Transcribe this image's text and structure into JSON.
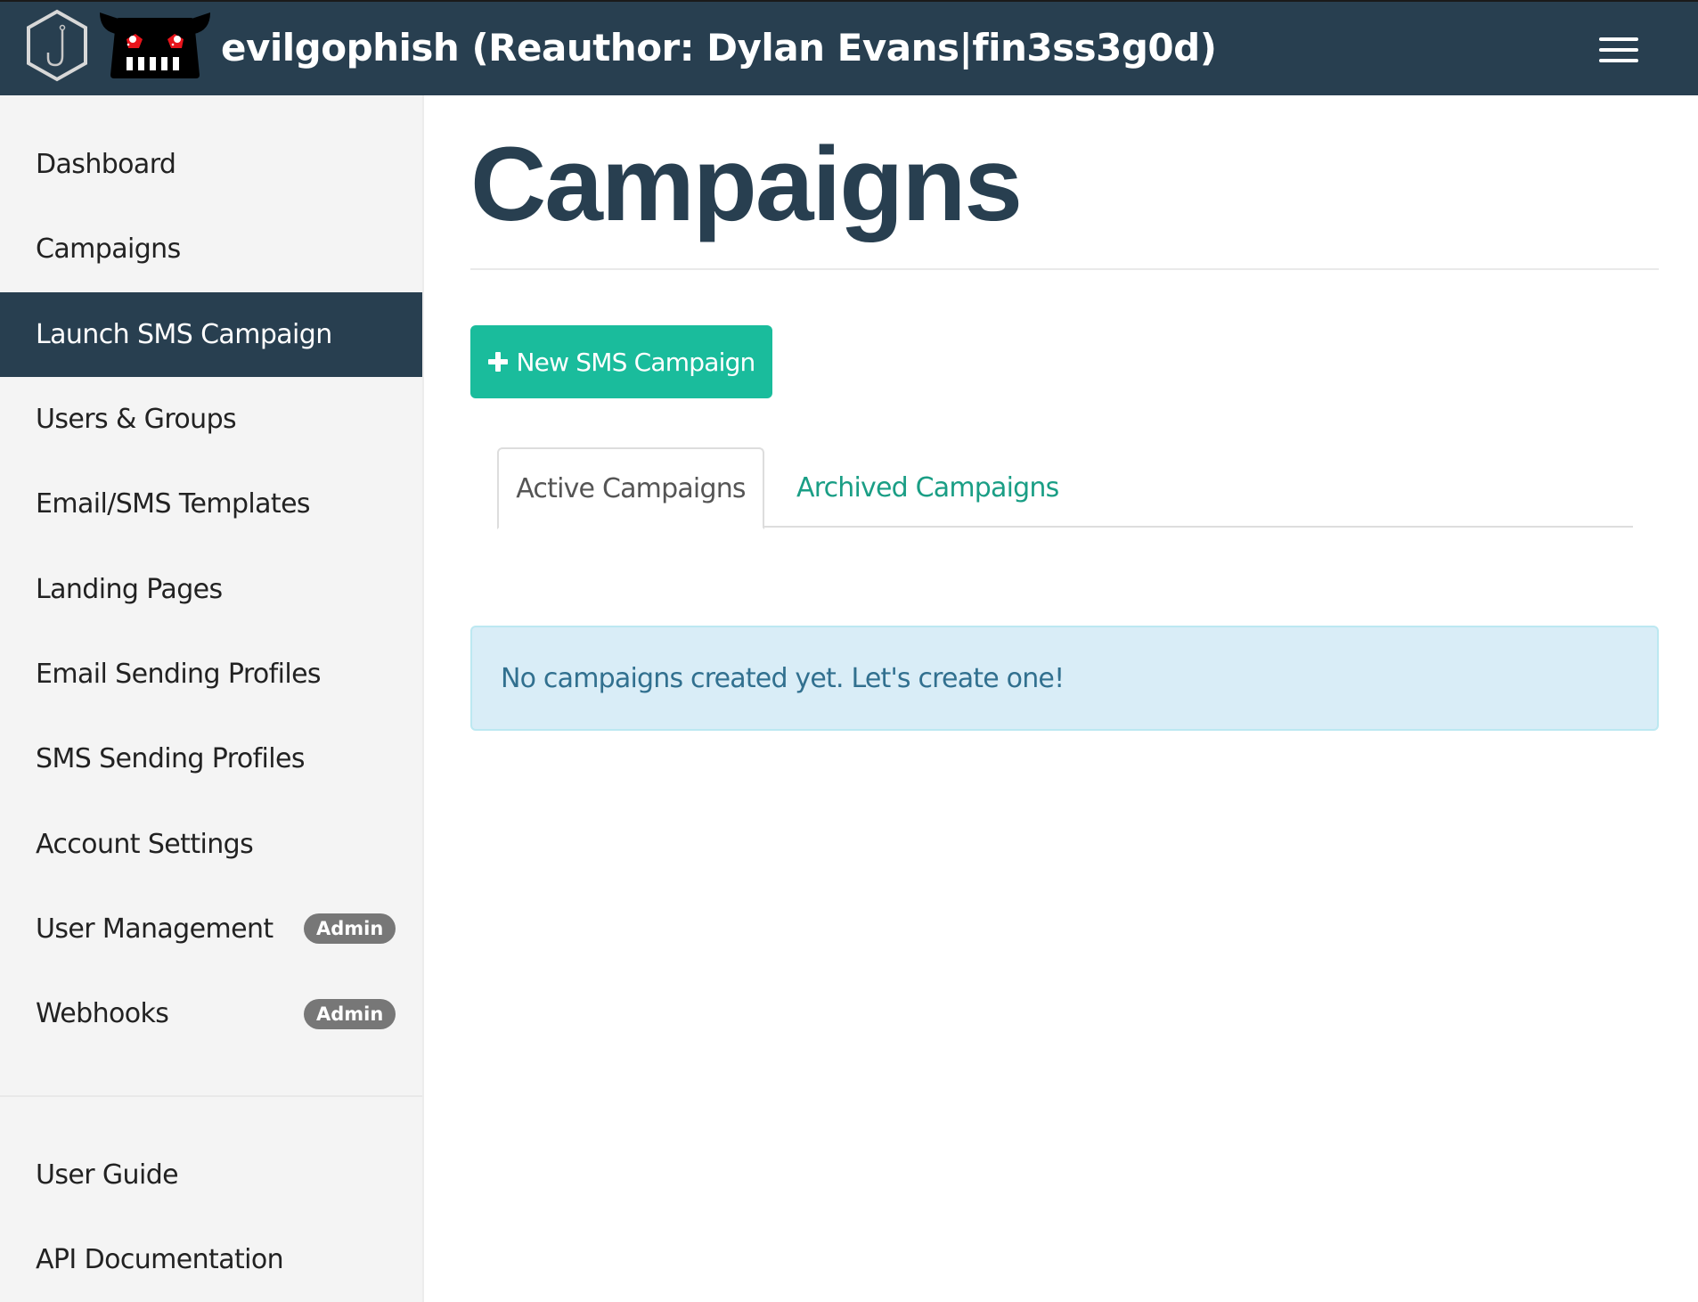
{
  "header": {
    "brand": "evilgophish (Reauthor: Dylan Evans|fin3ss3g0d)",
    "logo_icon": "hook-hexagon-icon",
    "mascot_icon": "evil-gopher-icon",
    "menu_icon": "hamburger-menu-icon"
  },
  "sidebar": {
    "items": [
      {
        "label": "Dashboard"
      },
      {
        "label": "Campaigns"
      },
      {
        "label": "Launch SMS Campaign",
        "active": true
      },
      {
        "label": "Users & Groups"
      },
      {
        "label": "Email/SMS Templates"
      },
      {
        "label": "Landing Pages"
      },
      {
        "label": "Email Sending Profiles"
      },
      {
        "label": "SMS Sending Profiles"
      },
      {
        "label": "Account Settings"
      },
      {
        "label": "User Management",
        "badge": "Admin"
      },
      {
        "label": "Webhooks",
        "badge": "Admin"
      }
    ],
    "secondary_items": [
      {
        "label": "User Guide"
      },
      {
        "label": "API Documentation"
      }
    ]
  },
  "main": {
    "title": "Campaigns",
    "new_button_label": "New SMS Campaign",
    "tabs": [
      {
        "label": "Active Campaigns",
        "active": true
      },
      {
        "label": "Archived Campaigns",
        "active": false
      }
    ],
    "alert_text": "No campaigns created yet. Let's create one!"
  },
  "colors": {
    "navbar": "#283f50",
    "accent": "#1abc9c",
    "link": "#1a9e85",
    "alert_bg": "#d9edf7",
    "alert_text": "#31708f",
    "badge": "#777777"
  }
}
